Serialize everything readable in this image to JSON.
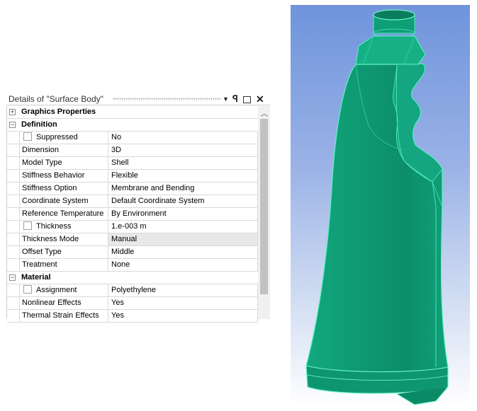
{
  "details_panel": {
    "title": "Details of \"Surface Body\"",
    "header_icons": [
      "dropdown-arrow-icon",
      "pin-icon",
      "maximize-icon",
      "close-icon"
    ],
    "groups": [
      {
        "label": "Graphics Properties",
        "expanded": false
      },
      {
        "label": "Definition",
        "expanded": true
      },
      {
        "label": "Material",
        "expanded": true
      }
    ],
    "definition_rows": [
      {
        "name": "Suppressed",
        "value": "No",
        "checkbox": true
      },
      {
        "name": "Dimension",
        "value": "3D"
      },
      {
        "name": "Model Type",
        "value": "Shell"
      },
      {
        "name": "Stiffness Behavior",
        "value": "Flexible"
      },
      {
        "name": "Stiffness Option",
        "value": "Membrane and Bending"
      },
      {
        "name": "Coordinate System",
        "value": "Default Coordinate System"
      },
      {
        "name": "Reference Temperature",
        "value": "By Environment"
      },
      {
        "name": "Thickness",
        "value": "1.e-003 m",
        "checkbox": true
      },
      {
        "name": "Thickness Mode",
        "value": "Manual",
        "highlighted": true
      },
      {
        "name": "Offset Type",
        "value": "Middle"
      },
      {
        "name": "Treatment",
        "value": "None"
      }
    ],
    "material_rows": [
      {
        "name": "Assignment",
        "value": "Polyethylene",
        "checkbox": true
      },
      {
        "name": "Nonlinear Effects",
        "value": "Yes"
      },
      {
        "name": "Thermal Strain Effects",
        "value": "Yes"
      }
    ]
  },
  "viewport": {
    "model": "surface-body-bottle",
    "body_color": "#0fa27a",
    "edge_color": "#5ef2c4",
    "background_top": "#6f94dc",
    "background_bottom": "#ffffff"
  }
}
